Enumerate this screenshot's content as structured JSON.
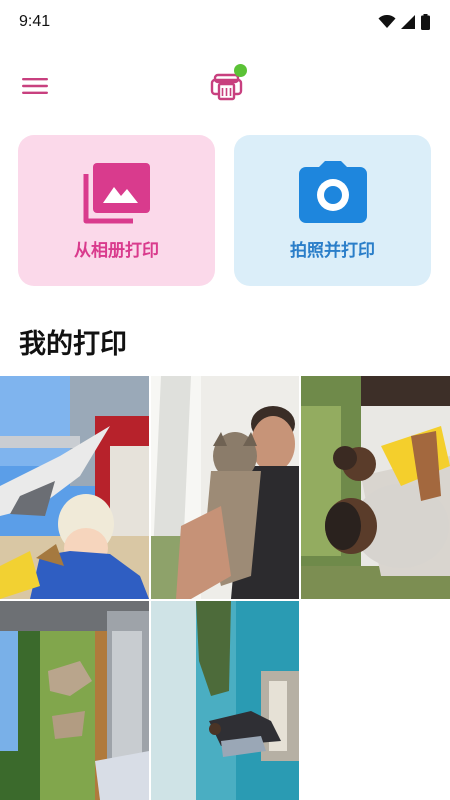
{
  "status_bar": {
    "time": "9:41",
    "icons": [
      "wifi-icon",
      "cellular-signal-icon",
      "battery-icon"
    ]
  },
  "app_bar": {
    "menu_icon": "hamburger-menu-icon",
    "printer_icon": "printer-icon",
    "printer_status_color": "#5bc236"
  },
  "actions": {
    "album": {
      "label": "从相册打印",
      "icon": "gallery-icon",
      "color": "#d93b8d",
      "background": "#fbd9ea"
    },
    "camera": {
      "label": "拍照并打印",
      "icon": "camera-icon",
      "color": "#2a7ec9",
      "background": "#dbeef9"
    }
  },
  "my_prints": {
    "title": "我的打印",
    "photos": [
      {
        "id": "child-with-pigeon"
      },
      {
        "id": "man-with-cat"
      },
      {
        "id": "father-and-daughter"
      },
      {
        "id": "goats-on-grass"
      },
      {
        "id": "couple-by-lake"
      }
    ]
  }
}
